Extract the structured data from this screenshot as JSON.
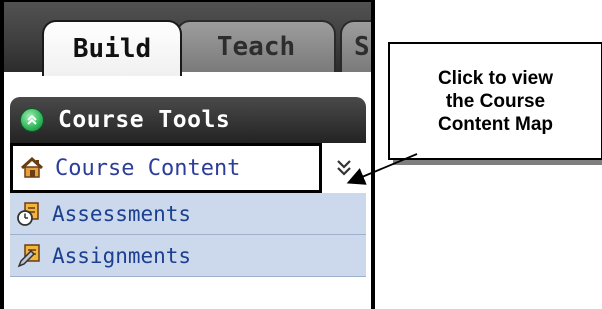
{
  "tabs": [
    {
      "label": "Build",
      "active": true
    },
    {
      "label": "Teach",
      "active": false
    },
    {
      "label": "St",
      "active": false
    }
  ],
  "course_tools": {
    "title": "Course Tools",
    "icon": "collapse-up-icon"
  },
  "menu": {
    "items": [
      {
        "label": "Course Content",
        "icon": "home-icon",
        "active": true
      },
      {
        "label": "Assessments",
        "icon": "assessment-clock-icon",
        "active": false
      },
      {
        "label": "Assignments",
        "icon": "assignment-pencil-icon",
        "active": false
      }
    ],
    "expand_icon": "double-chevron-down-icon"
  },
  "callout": {
    "text": "Click to view\nthe Course\nContent Map"
  },
  "colors": {
    "menu_bg": "#ccd9ec",
    "menu_text": "#1c3f8f",
    "header_bg": "#232323",
    "tab_active_bg": "#ffffff",
    "tab_inactive_bg": "#8a8a8a"
  }
}
